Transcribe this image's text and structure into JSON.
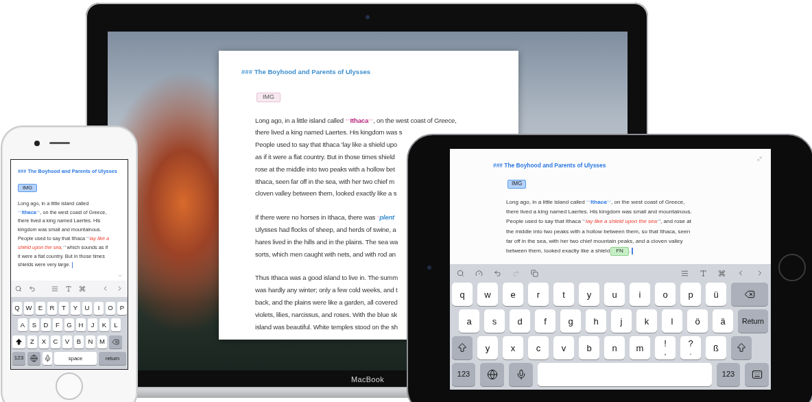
{
  "laptop": {
    "brand": "MacBook",
    "document": {
      "heading": "### The Boyhood and Parents of Ulysses",
      "image_tag": "IMG",
      "paragraphs": [
        {
          "lines": [
            [
              {
                "kind": "text",
                "text": "Long ago, in a little island called "
              },
              {
                "kind": "mark",
                "text": "**"
              },
              {
                "kind": "strong",
                "text": "Ithaca"
              },
              {
                "kind": "mark",
                "text": "**"
              },
              {
                "kind": "text",
                "text": ", on the west coast of Greece,"
              }
            ],
            [
              {
                "kind": "text",
                "text": "there lived a king named Laertes. His kingdom was s"
              }
            ],
            [
              {
                "kind": "text",
                "text": "People used to say that Ithaca ‘lay like a shield upo"
              }
            ],
            [
              {
                "kind": "text",
                "text": "as if it were a flat country. But in those times shield"
              }
            ],
            [
              {
                "kind": "text",
                "text": "rose at the middle into two peaks with a hollow bet"
              }
            ],
            [
              {
                "kind": "text",
                "text": "Ithaca, seen far off in the sea, with her two chief m"
              }
            ],
            [
              {
                "kind": "text",
                "text": "cloven valley between them, looked exactly like a s"
              }
            ]
          ]
        },
        {
          "lines": [
            [
              {
                "kind": "text",
                "text": "If there were no horses in Ithaca, there was "
              },
              {
                "kind": "mark",
                "text": "*"
              },
              {
                "kind": "emphasis",
                "text": "plent"
              }
            ],
            [
              {
                "kind": "text",
                "text": "Ulysses had flocks of sheep, and herds of swine, a"
              }
            ],
            [
              {
                "kind": "text",
                "text": "hares lived in the hills and in the plains. The sea wa"
              }
            ],
            [
              {
                "kind": "text",
                "text": "sorts, which men caught with nets, and with rod an"
              }
            ]
          ]
        },
        {
          "lines": [
            [
              {
                "kind": "text",
                "text": "Thus Ithaca was a good island to live in. The summ"
              }
            ],
            [
              {
                "kind": "text",
                "text": "was hardly any winter; only a few cold weeks, and t"
              }
            ],
            [
              {
                "kind": "text",
                "text": "back, and the plains were like a garden, all covered"
              }
            ],
            [
              {
                "kind": "text",
                "text": "violets, lilies, narcissus, and roses. With the blue sk"
              }
            ],
            [
              {
                "kind": "text",
                "text": "island was beautiful. White temples stood on the sh"
              }
            ]
          ]
        }
      ]
    }
  },
  "phone": {
    "document": {
      "heading": "### The Boyhood and Parents of Ulysses",
      "image_tag": "IMG",
      "paragraph": {
        "cursor": true,
        "lines": [
          [
            {
              "kind": "text",
              "text": "Long ago, in a little island called"
            }
          ],
          [
            {
              "kind": "mark",
              "text": "**"
            },
            {
              "kind": "strong",
              "text": "Ithaca"
            },
            {
              "kind": "mark",
              "text": "**"
            },
            {
              "kind": "text",
              "text": ", on the west coast of Greece,"
            }
          ],
          [
            {
              "kind": "text",
              "text": "there lived a king named Laertes. His"
            }
          ],
          [
            {
              "kind": "text",
              "text": "kingdom was small and mountainous."
            }
          ],
          [
            {
              "kind": "text",
              "text": "People used to say that Ithaca ‘"
            },
            {
              "kind": "mark",
              "text": "*"
            },
            {
              "kind": "emphasis",
              "text": "lay like a"
            }
          ],
          [
            {
              "kind": "emphasis",
              "text": "shield upon the sea,"
            },
            {
              "kind": "mark",
              "text": "*"
            },
            {
              "kind": "text",
              "text": "’ which sounds as if"
            }
          ],
          [
            {
              "kind": "text",
              "text": "it were a flat country. But in those times"
            }
          ],
          [
            {
              "kind": "text",
              "text": "shields were very large."
            }
          ]
        ]
      }
    },
    "keyboard": {
      "rows": [
        {
          "keys": [
            {
              "kind": "letter",
              "label": "Q"
            },
            {
              "kind": "letter",
              "label": "W"
            },
            {
              "kind": "letter",
              "label": "E"
            },
            {
              "kind": "letter",
              "label": "R"
            },
            {
              "kind": "letter",
              "label": "T"
            },
            {
              "kind": "letter",
              "label": "Y"
            },
            {
              "kind": "letter",
              "label": "U"
            },
            {
              "kind": "letter",
              "label": "I"
            },
            {
              "kind": "letter",
              "label": "O"
            },
            {
              "kind": "letter",
              "label": "P"
            }
          ]
        },
        {
          "keys": [
            {
              "kind": "letter",
              "label": "A"
            },
            {
              "kind": "letter",
              "label": "S"
            },
            {
              "kind": "letter",
              "label": "D"
            },
            {
              "kind": "letter",
              "label": "F"
            },
            {
              "kind": "letter",
              "label": "G"
            },
            {
              "kind": "letter",
              "label": "H"
            },
            {
              "kind": "letter",
              "label": "J"
            },
            {
              "kind": "letter",
              "label": "K"
            },
            {
              "kind": "letter",
              "label": "L"
            }
          ]
        },
        {
          "keys": [
            {
              "kind": "shift",
              "on": true
            },
            {
              "kind": "letter",
              "label": "Z"
            },
            {
              "kind": "letter",
              "label": "X"
            },
            {
              "kind": "letter",
              "label": "C"
            },
            {
              "kind": "letter",
              "label": "V"
            },
            {
              "kind": "letter",
              "label": "B"
            },
            {
              "kind": "letter",
              "label": "N"
            },
            {
              "kind": "letter",
              "label": "M"
            },
            {
              "kind": "delete"
            }
          ]
        },
        {
          "keys": [
            {
              "kind": "numbers",
              "label": "123"
            },
            {
              "kind": "globe"
            },
            {
              "kind": "mic"
            },
            {
              "kind": "space",
              "label": "space"
            },
            {
              "kind": "return",
              "label": "return"
            }
          ]
        }
      ]
    }
  },
  "tablet": {
    "document": {
      "heading": "### The Boyhood and Parents of Ulysses",
      "image_tag": "IMG",
      "paragraph": {
        "cursor": true,
        "lines": [
          [
            {
              "kind": "text",
              "text": "Long ago, in a little island called "
            },
            {
              "kind": "mark",
              "text": "**"
            },
            {
              "kind": "strong",
              "text": "Ithaca"
            },
            {
              "kind": "mark",
              "text": "**"
            },
            {
              "kind": "text",
              "text": ", on the west coast of Greece,"
            }
          ],
          [
            {
              "kind": "text",
              "text": "there lived a king named Laertes. His kingdom was small and mountainous."
            }
          ],
          [
            {
              "kind": "text",
              "text": "People used to say that Ithaca ‘"
            },
            {
              "kind": "mark",
              "text": "*"
            },
            {
              "kind": "emphasis",
              "text": "lay like a shield upon the sea"
            },
            {
              "kind": "mark",
              "text": "*"
            },
            {
              "kind": "text",
              "text": "’, and rose at"
            }
          ],
          [
            {
              "kind": "text",
              "text": "the middle into two peaks with a hollow between them, so that Ithaca, seen"
            }
          ],
          [
            {
              "kind": "text",
              "text": "far off in the sea, with her two chief mountain peaks, and a cloven valley"
            }
          ],
          [
            {
              "kind": "text",
              "text": "between them, looked exactly like a shield"
            },
            {
              "kind": "tag",
              "text": "FN"
            },
            {
              "kind": "text",
              "text": "."
            }
          ]
        ]
      }
    },
    "keyboard": {
      "rows": [
        {
          "keys": [
            {
              "kind": "letter",
              "label": "q"
            },
            {
              "kind": "letter",
              "label": "w"
            },
            {
              "kind": "letter",
              "label": "e"
            },
            {
              "kind": "letter",
              "label": "r"
            },
            {
              "kind": "letter",
              "label": "t"
            },
            {
              "kind": "letter",
              "label": "y"
            },
            {
              "kind": "letter",
              "label": "u"
            },
            {
              "kind": "letter",
              "label": "i"
            },
            {
              "kind": "letter",
              "label": "o"
            },
            {
              "kind": "letter",
              "label": "p"
            },
            {
              "kind": "letter",
              "label": "ü"
            },
            {
              "kind": "delete"
            }
          ]
        },
        {
          "keys": [
            {
              "kind": "letter",
              "label": "a"
            },
            {
              "kind": "letter",
              "label": "s"
            },
            {
              "kind": "letter",
              "label": "d"
            },
            {
              "kind": "letter",
              "label": "f"
            },
            {
              "kind": "letter",
              "label": "g"
            },
            {
              "kind": "letter",
              "label": "h"
            },
            {
              "kind": "letter",
              "label": "j"
            },
            {
              "kind": "letter",
              "label": "k"
            },
            {
              "kind": "letter",
              "label": "l"
            },
            {
              "kind": "letter",
              "label": "ö"
            },
            {
              "kind": "letter",
              "label": "ä"
            },
            {
              "kind": "return",
              "label": "Return"
            }
          ]
        },
        {
          "keys": [
            {
              "kind": "shift",
              "on": false
            },
            {
              "kind": "letter",
              "label": "y"
            },
            {
              "kind": "letter",
              "label": "x"
            },
            {
              "kind": "letter",
              "label": "c"
            },
            {
              "kind": "letter",
              "label": "v"
            },
            {
              "kind": "letter",
              "label": "b"
            },
            {
              "kind": "letter",
              "label": "n"
            },
            {
              "kind": "letter",
              "label": "m"
            },
            {
              "kind": "letter",
              "label": "!",
              "sub": ","
            },
            {
              "kind": "letter",
              "label": "?",
              "sub": "."
            },
            {
              "kind": "letter",
              "label": "ß"
            },
            {
              "kind": "shift",
              "on": false
            }
          ]
        },
        {
          "keys": [
            {
              "kind": "numbers",
              "label": "123"
            },
            {
              "kind": "globe"
            },
            {
              "kind": "mic"
            },
            {
              "kind": "space"
            },
            {
              "kind": "numbers",
              "label": "123"
            },
            {
              "kind": "hide"
            }
          ]
        }
      ]
    }
  }
}
